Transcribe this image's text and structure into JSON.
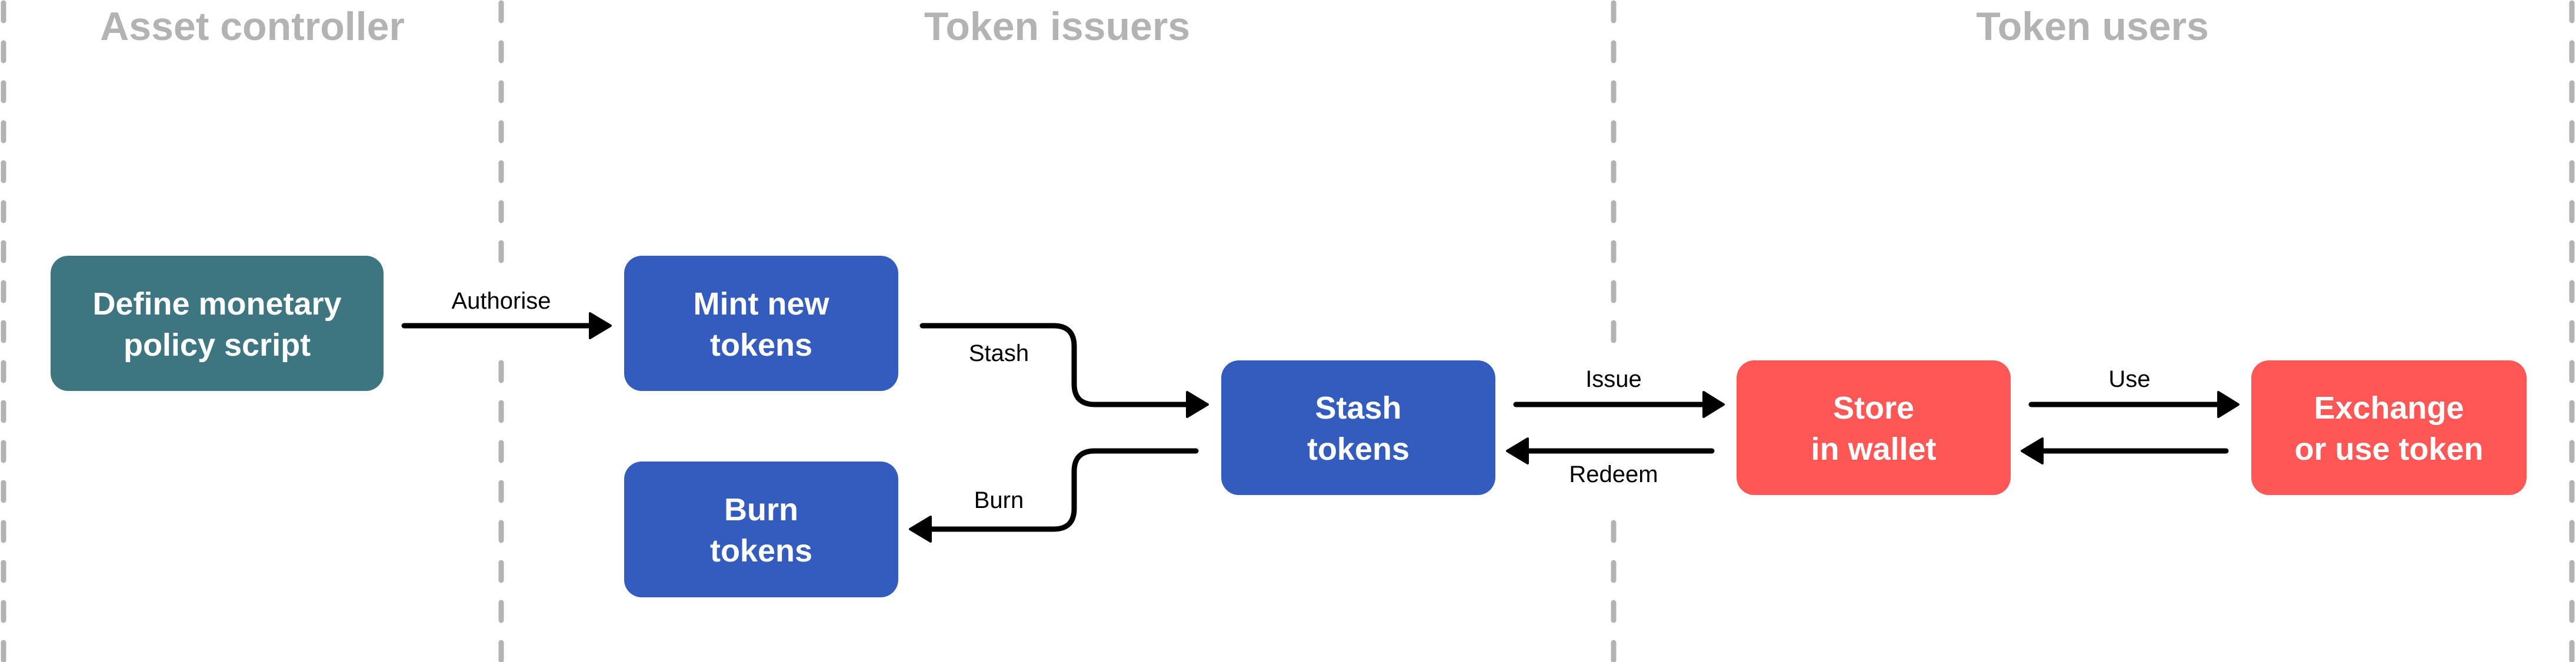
{
  "colors": {
    "background": "#ffffff",
    "lane_title": "#b3b3b3",
    "divider": "#b3b3b3",
    "controller": "#3d7680",
    "issuer": "#345cbe",
    "user": "#ff5656",
    "edge": "#000000",
    "node_text": "#ffffff"
  },
  "lanes": [
    {
      "id": "asset-controller",
      "title": "Asset controller"
    },
    {
      "id": "token-issuers",
      "title": "Token issuers"
    },
    {
      "id": "token-users",
      "title": "Token users"
    }
  ],
  "nodes": [
    {
      "id": "define-policy",
      "lane": "asset-controller",
      "role": "controller",
      "lines": [
        "Define monetary",
        "policy script"
      ]
    },
    {
      "id": "mint",
      "lane": "token-issuers",
      "role": "issuer",
      "lines": [
        "Mint new",
        "tokens"
      ]
    },
    {
      "id": "burn",
      "lane": "token-issuers",
      "role": "issuer",
      "lines": [
        "Burn",
        "tokens"
      ]
    },
    {
      "id": "stash",
      "lane": "token-issuers",
      "role": "issuer",
      "lines": [
        "Stash",
        "tokens"
      ]
    },
    {
      "id": "store",
      "lane": "token-users",
      "role": "user",
      "lines": [
        "Store",
        "in wallet"
      ]
    },
    {
      "id": "exchange",
      "lane": "token-users",
      "role": "user",
      "lines": [
        "Exchange",
        "or use token"
      ]
    }
  ],
  "edges": [
    {
      "id": "authorise",
      "from": "define-policy",
      "to": "mint",
      "label": "Authorise"
    },
    {
      "id": "stash",
      "from": "mint",
      "to": "stash",
      "label": "Stash"
    },
    {
      "id": "burn",
      "from": "stash",
      "to": "burn",
      "label": "Burn"
    },
    {
      "id": "issue",
      "from": "stash",
      "to": "store",
      "label": "Issue"
    },
    {
      "id": "redeem",
      "from": "store",
      "to": "stash",
      "label": "Redeem"
    },
    {
      "id": "use",
      "from": "store",
      "to": "exchange",
      "label": "Use"
    },
    {
      "id": "return",
      "from": "exchange",
      "to": "store",
      "label": ""
    }
  ]
}
